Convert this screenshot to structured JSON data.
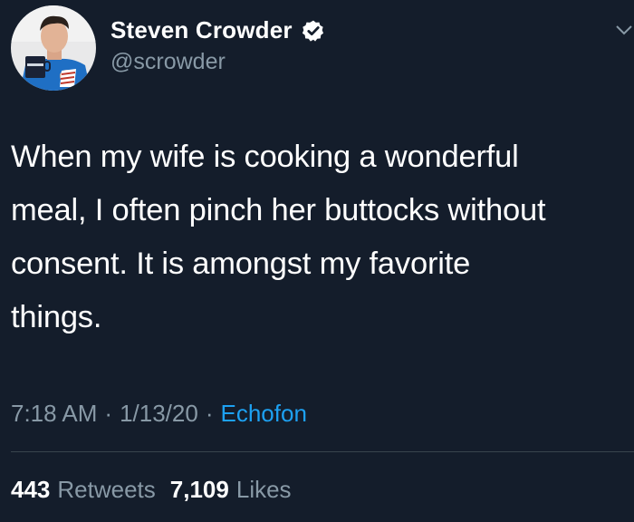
{
  "author": {
    "display_name": "Steven Crowder",
    "handle": "@scrowder",
    "avatar_icon": "profile-photo",
    "verified_icon": "verified-badge-icon"
  },
  "tweet": {
    "text": "When my wife is cooking a wonderful\nmeal, I often pinch her buttocks without\nconsent. It is amongst my favorite\nthings.",
    "time": "7:18 AM",
    "date": "1/13/20",
    "source": "Echofon",
    "separator": "·"
  },
  "stats": {
    "retweets_count": "443",
    "retweets_label": "Retweets",
    "likes_count": "7,109",
    "likes_label": "Likes"
  },
  "colors": {
    "background": "#141d2b",
    "secondary_text": "#8899a6",
    "link": "#1da1f2",
    "divider": "#38444d"
  }
}
